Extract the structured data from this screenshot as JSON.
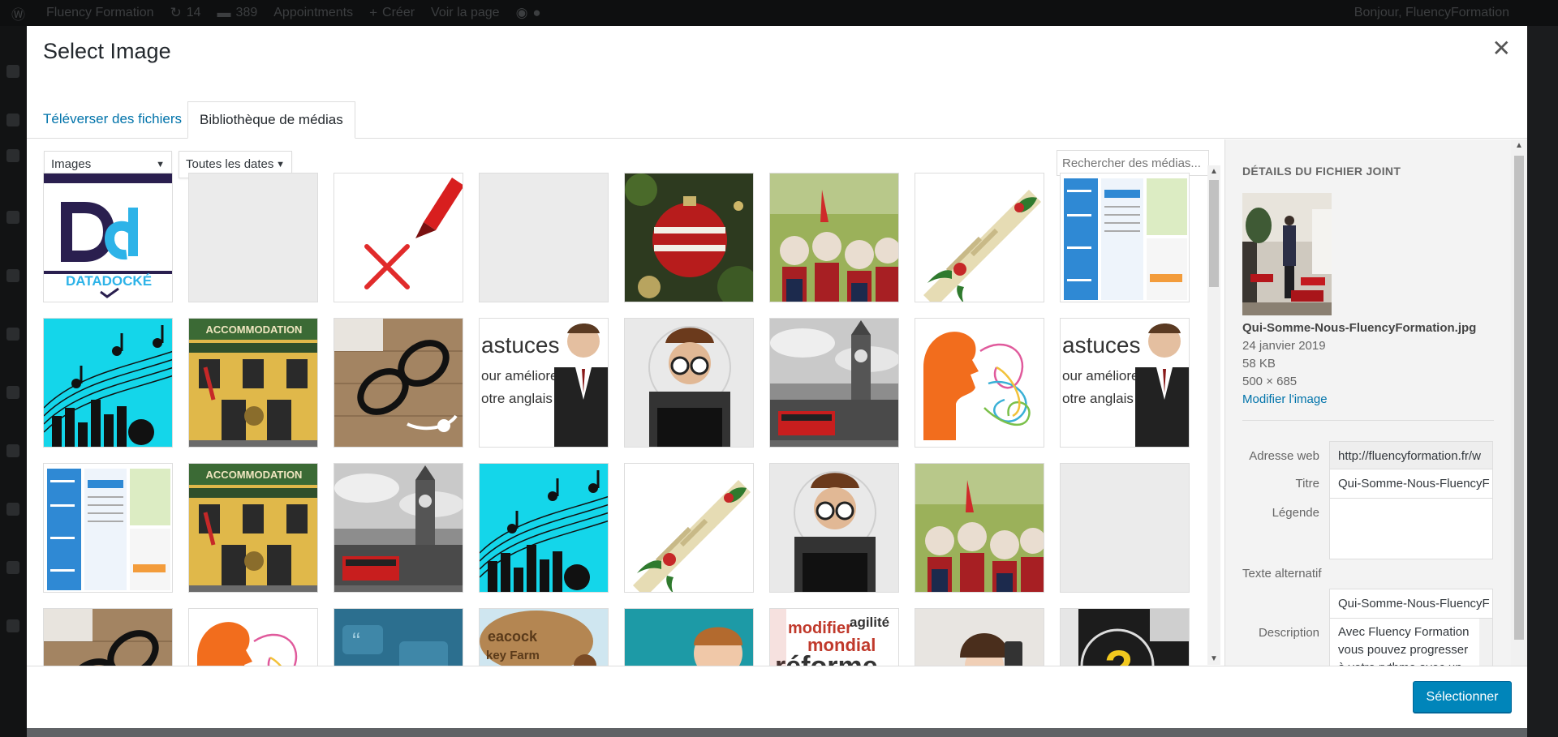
{
  "admin_bar": {
    "site_name": "Fluency Formation",
    "updates": "14",
    "comments": "389",
    "appointments": "Appointments",
    "create": "Créer",
    "view_page": "Voir la page",
    "greeting": "Bonjour, FluencyFormation"
  },
  "modal": {
    "title": "Select Image",
    "close_icon": "close-icon",
    "tabs": [
      "Téléverser des fichiers",
      "Bibliothèque de médias"
    ],
    "active_tab": 1
  },
  "toolbar": {
    "type_filter": "Images",
    "date_filter": "Toutes les dates",
    "search_placeholder": "Rechercher des médias..."
  },
  "grid": {
    "items": [
      {
        "kind": "datadock",
        "label": "DATADOCKÉ"
      },
      {
        "kind": "blank"
      },
      {
        "kind": "redx"
      },
      {
        "kind": "blank"
      },
      {
        "kind": "ornament"
      },
      {
        "kind": "folk"
      },
      {
        "kind": "cracker"
      },
      {
        "kind": "website"
      },
      {
        "kind": "music"
      },
      {
        "kind": "pub",
        "label": "ACCOMMODATION"
      },
      {
        "kind": "glasses"
      },
      {
        "kind": "astuces",
        "lines": [
          "astuces",
          "our améliorer",
          "otre anglais"
        ]
      },
      {
        "kind": "geek"
      },
      {
        "kind": "bigben"
      },
      {
        "kind": "head"
      },
      {
        "kind": "astuces",
        "lines": [
          "astuces",
          "our améliorer",
          "otre anglais"
        ]
      },
      {
        "kind": "website"
      },
      {
        "kind": "pub",
        "label": "ACCOMMODATION"
      },
      {
        "kind": "bigben"
      },
      {
        "kind": "music"
      },
      {
        "kind": "cracker"
      },
      {
        "kind": "geek"
      },
      {
        "kind": "folk"
      },
      {
        "kind": "blank"
      },
      {
        "kind": "glasses"
      },
      {
        "kind": "head"
      },
      {
        "kind": "quotes"
      },
      {
        "kind": "peacock",
        "lines": [
          "eacock",
          "key Farm"
        ]
      },
      {
        "kind": "survey"
      },
      {
        "kind": "words",
        "lines": [
          "modifier",
          "agilité",
          "mondial",
          "réforme"
        ]
      },
      {
        "kind": "phone"
      },
      {
        "kind": "question"
      }
    ]
  },
  "details": {
    "heading": "DÉTAILS DU FICHIER JOINT",
    "filename": "Qui-Somme-Nous-FluencyFormation.jpg",
    "date": "24 janvier 2019",
    "size": "58 KB",
    "dimensions": "500 × 685",
    "edit_link": "Modifier l'image",
    "fields": {
      "url_label": "Adresse web",
      "url_value": "http://fluencyformation.fr/w",
      "title_label": "Titre",
      "title_value": "Qui-Somme-Nous-FluencyF",
      "caption_label": "Légende",
      "caption_value": "",
      "alt_label": "Texte alternatif",
      "alt_value": "Qui-Somme-Nous-FluencyF",
      "desc_label": "Description",
      "desc_value": "Avec Fluency Formation vous pouvez progresser à votre rythme avec un"
    }
  },
  "footer": {
    "select_button": "Sélectionner"
  },
  "colors": {
    "primary": "#0085ba",
    "link": "#0073aa"
  }
}
